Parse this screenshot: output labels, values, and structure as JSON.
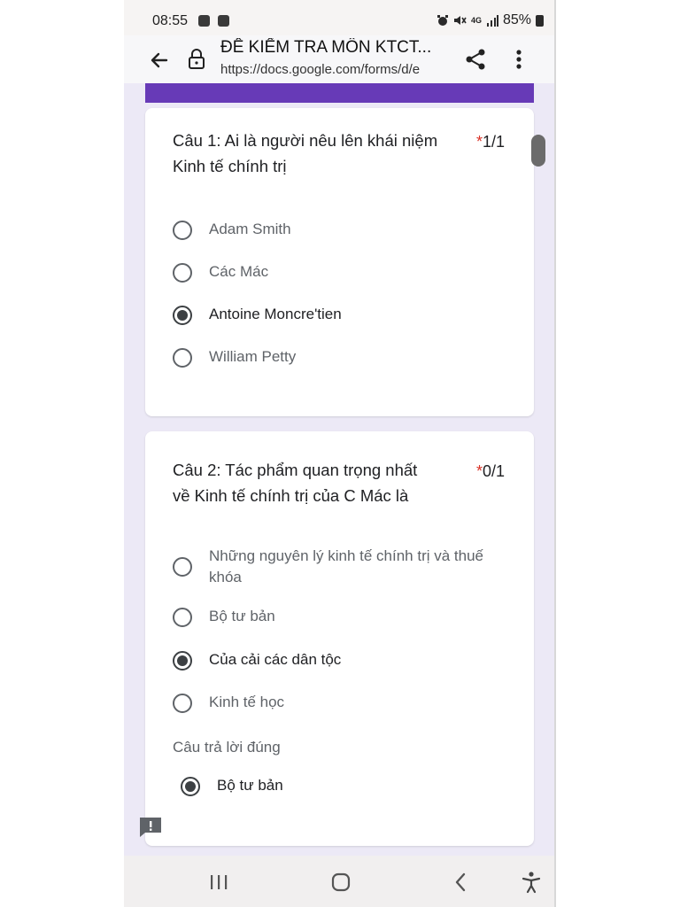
{
  "status_bar": {
    "time": "08:55",
    "network": "4G",
    "battery": "85%"
  },
  "browser": {
    "title": "ĐỀ KIỂM TRA MÔN KTCT...",
    "url": "https://docs.google.com/forms/d/e"
  },
  "colors": {
    "form_accent": "#673ab7",
    "required_star": "#d93025",
    "page_bg": "#ece9f6"
  },
  "questions": [
    {
      "text": "Câu 1:     Ai là người nêu lên khái niệm Kinh tế chính trị",
      "required_mark": "*",
      "score": "1/1",
      "options": [
        "Adam Smith",
        "Các Mác",
        "Antoine Moncre'tien",
        "William Petty"
      ],
      "selected": "Antoine Moncre'tien"
    },
    {
      "text": "Câu 2: Tác phẩm quan trọng nhất về Kinh tế chính trị của C Mác là",
      "required_mark": "*",
      "score": "0/1",
      "options": [
        "Những nguyên lý kinh tế chính trị và thuế khóa",
        "Bộ tư bản",
        "Của cải các dân tộc",
        "Kinh tế học"
      ],
      "selected": "Của cải các dân tộc",
      "correct_answer_title": "Câu trả lời đúng",
      "correct_answer": "Bộ tư bản"
    }
  ],
  "icons": [
    "back-arrow-icon",
    "lock-icon",
    "share-icon",
    "more-vert-icon",
    "feedback-icon",
    "recent-apps-icon",
    "home-icon",
    "nav-back-icon",
    "accessibility-icon"
  ]
}
